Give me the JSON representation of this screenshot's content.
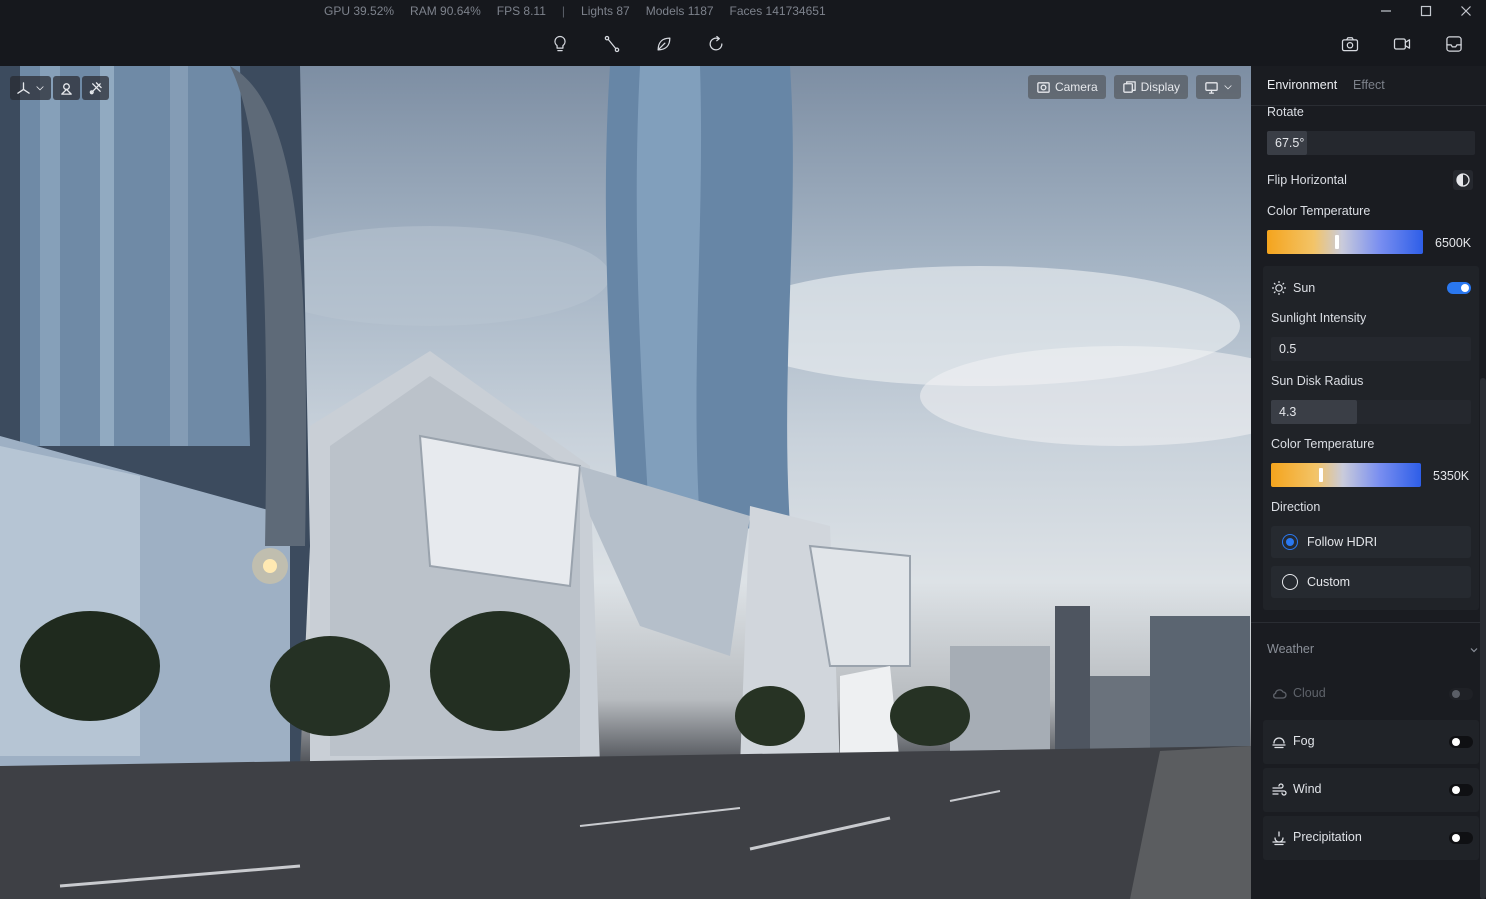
{
  "stats": {
    "gpu": "GPU 39.52%",
    "ram": "RAM 90.64%",
    "fps": "FPS 8.11",
    "separator": "|",
    "lights": "Lights 87",
    "models": "Models 1187",
    "faces": "Faces 141734651"
  },
  "window_controls": [
    "minimize-icon",
    "maximize-icon",
    "close-icon"
  ],
  "toolbar": {
    "center_icons": [
      "lightbulb-icon",
      "path-tool-icon",
      "leaf-icon",
      "refresh-icon"
    ],
    "right_icons": [
      "camera-snapshot-icon",
      "video-record-icon",
      "tray-icon"
    ]
  },
  "viewport": {
    "overlay_left_icons": [
      "axis-gizmo-icon",
      "focus-target-icon",
      "satellite-icon"
    ],
    "camera_label": "Camera",
    "display_label": "Display",
    "render_dropdown_icon": "monitor-icon"
  },
  "panel": {
    "tabs": {
      "environment": "Environment",
      "effect": "Effect"
    },
    "rotate": {
      "label": "Rotate",
      "value": "67.5°",
      "fraction": 0.19
    },
    "flip_horizontal": {
      "label": "Flip Horizontal"
    },
    "color_temperature": {
      "label": "Color Temperature",
      "value": "6500K",
      "fraction": 0.45
    },
    "sun": {
      "label": "Sun",
      "enabled": true,
      "sunlight_intensity": {
        "label": "Sunlight Intensity",
        "value": "0.5",
        "fraction": 0.0
      },
      "sun_disk_radius": {
        "label": "Sun Disk Radius",
        "value": "4.3",
        "fraction": 0.43
      },
      "color_temperature": {
        "label": "Color Temperature",
        "value": "5350K",
        "fraction": 0.33
      },
      "direction": {
        "label": "Direction",
        "options": [
          "Follow HDRI",
          "Custom"
        ],
        "selected": "Follow HDRI"
      }
    },
    "weather": {
      "label": "Weather",
      "items": [
        {
          "label": "Cloud",
          "icon": "cloud-icon",
          "enabled": false,
          "disabled": true
        },
        {
          "label": "Fog",
          "icon": "fog-icon",
          "enabled": false
        },
        {
          "label": "Wind",
          "icon": "wind-icon",
          "enabled": false
        },
        {
          "label": "Precipitation",
          "icon": "precipitation-icon",
          "enabled": false
        }
      ]
    }
  },
  "colors": {
    "accent": "#2a78f0",
    "panel_bg": "#1a1c21",
    "card_bg": "#202328"
  }
}
